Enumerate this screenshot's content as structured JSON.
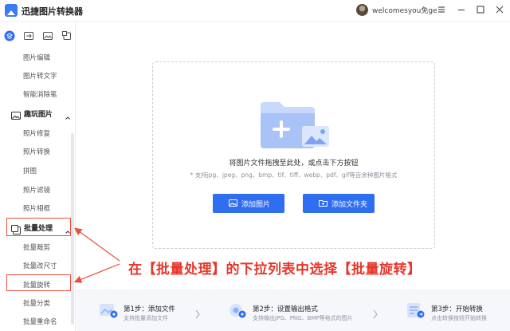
{
  "app": {
    "title": "迅捷图片转换器",
    "user_name": "welcomesyou免ge"
  },
  "sidebar": {
    "items_top": [
      "图片编辑",
      "图片转文字",
      "智能消除笔"
    ],
    "group_play": {
      "label": "趣玩图片",
      "items": [
        "照片修复",
        "照片转换",
        "拼图",
        "照片滤镜",
        "照片相框"
      ]
    },
    "group_batch": {
      "label": "批量处理",
      "items": [
        "批量裁剪",
        "批量改尺寸",
        "批量旋转",
        "批量分类",
        "批量重命名"
      ]
    }
  },
  "drop": {
    "main_text": "将图片文件拖拽至此处，或点击下方按钮",
    "sub_text": "* 支持jpg、jpeg、png、bmp、tif、tiff、webp、pdf、gif等百余种图片格式",
    "add_image_label": "添加图片",
    "add_folder_label": "添加文件夹"
  },
  "annotation": {
    "text": "在【批量处理】的下拉列表中选择【批量旋转】"
  },
  "steps": [
    {
      "title": "第1步：添加文件",
      "desc": "支持批量添加文件"
    },
    {
      "title": "第2步：设置输出格式",
      "desc": "支持输出JPG、PNG、BMP等格式的图片"
    },
    {
      "title": "第3步：开始转换",
      "desc": "点击转换按钮开始转换"
    }
  ],
  "colors": {
    "accent": "#2f6ef0",
    "annotation": "#e8362a",
    "highlight_border": "#e8503a"
  },
  "icons": {
    "logo": "app-logo-icon",
    "window": [
      "minimize-icon",
      "maximize-icon",
      "close-icon"
    ],
    "top_tabs": [
      "layers-icon",
      "convert-icon",
      "image-icon",
      "crop-icon"
    ]
  }
}
